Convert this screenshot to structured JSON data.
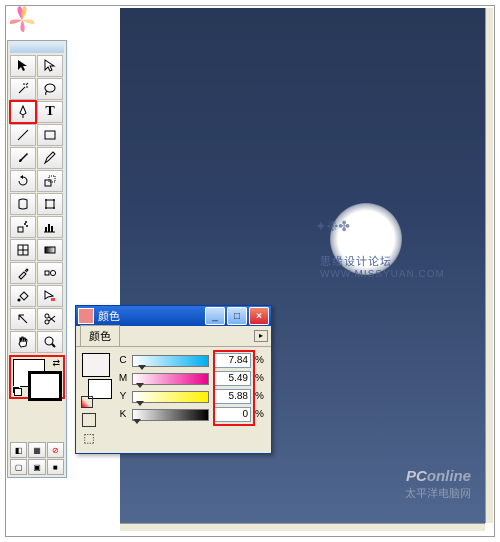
{
  "logo_name": "flower-logo",
  "toolbox": {
    "rows": [
      [
        "selection",
        "direct-selection"
      ],
      [
        "magic-wand",
        "lasso"
      ],
      [
        "pen",
        "type"
      ],
      [
        "line-segment",
        "rectangle"
      ],
      [
        "paintbrush",
        "pencil"
      ],
      [
        "rotate",
        "scale"
      ],
      [
        "warp",
        "free-transform"
      ],
      [
        "symbol-sprayer",
        "column-graph"
      ],
      [
        "mesh",
        "gradient"
      ],
      [
        "eyedropper",
        "blend"
      ],
      [
        "live-paint",
        "live-paint-select"
      ],
      [
        "slice",
        "scissors"
      ],
      [
        "hand",
        "zoom"
      ]
    ],
    "pen_selected": true,
    "draw_modes": [
      "color",
      "gradient",
      "none"
    ],
    "screen_modes": [
      "normal",
      "full-menu",
      "full"
    ]
  },
  "color_panel": {
    "title": "颜色",
    "tab": "颜色",
    "channels": [
      {
        "key": "C",
        "value": "7.84",
        "pos": 8
      },
      {
        "key": "M",
        "value": "5.49",
        "pos": 6
      },
      {
        "key": "Y",
        "value": "5.88",
        "pos": 6
      },
      {
        "key": "K",
        "value": "0",
        "pos": 0
      }
    ],
    "percent": "%"
  },
  "watermark": {
    "cn": "思缘设计论坛",
    "url": "WWW.MISSYUAN.COM",
    "cloud_glyphs": "✦ ❉ ✤"
  },
  "pconline": {
    "brand_pc": "PC",
    "brand_on": "online",
    "cn": "太平洋电脑网"
  }
}
